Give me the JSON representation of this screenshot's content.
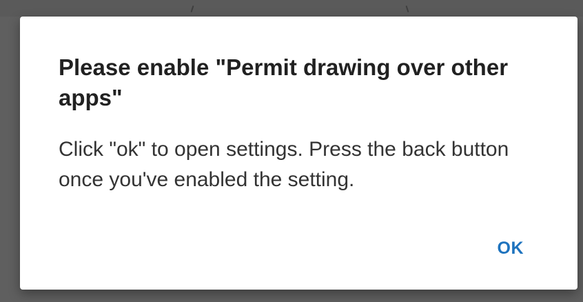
{
  "dialog": {
    "title": "Please enable \"Permit drawing over other apps\"",
    "message": "Click \"ok\" to open settings. Press the back button once you've enabled the setting.",
    "ok_label": "OK"
  },
  "colors": {
    "backdrop": "#5f5f5f",
    "dialog_background": "#ffffff",
    "title_text": "#212121",
    "message_text": "#333333",
    "accent": "#1e73be"
  }
}
